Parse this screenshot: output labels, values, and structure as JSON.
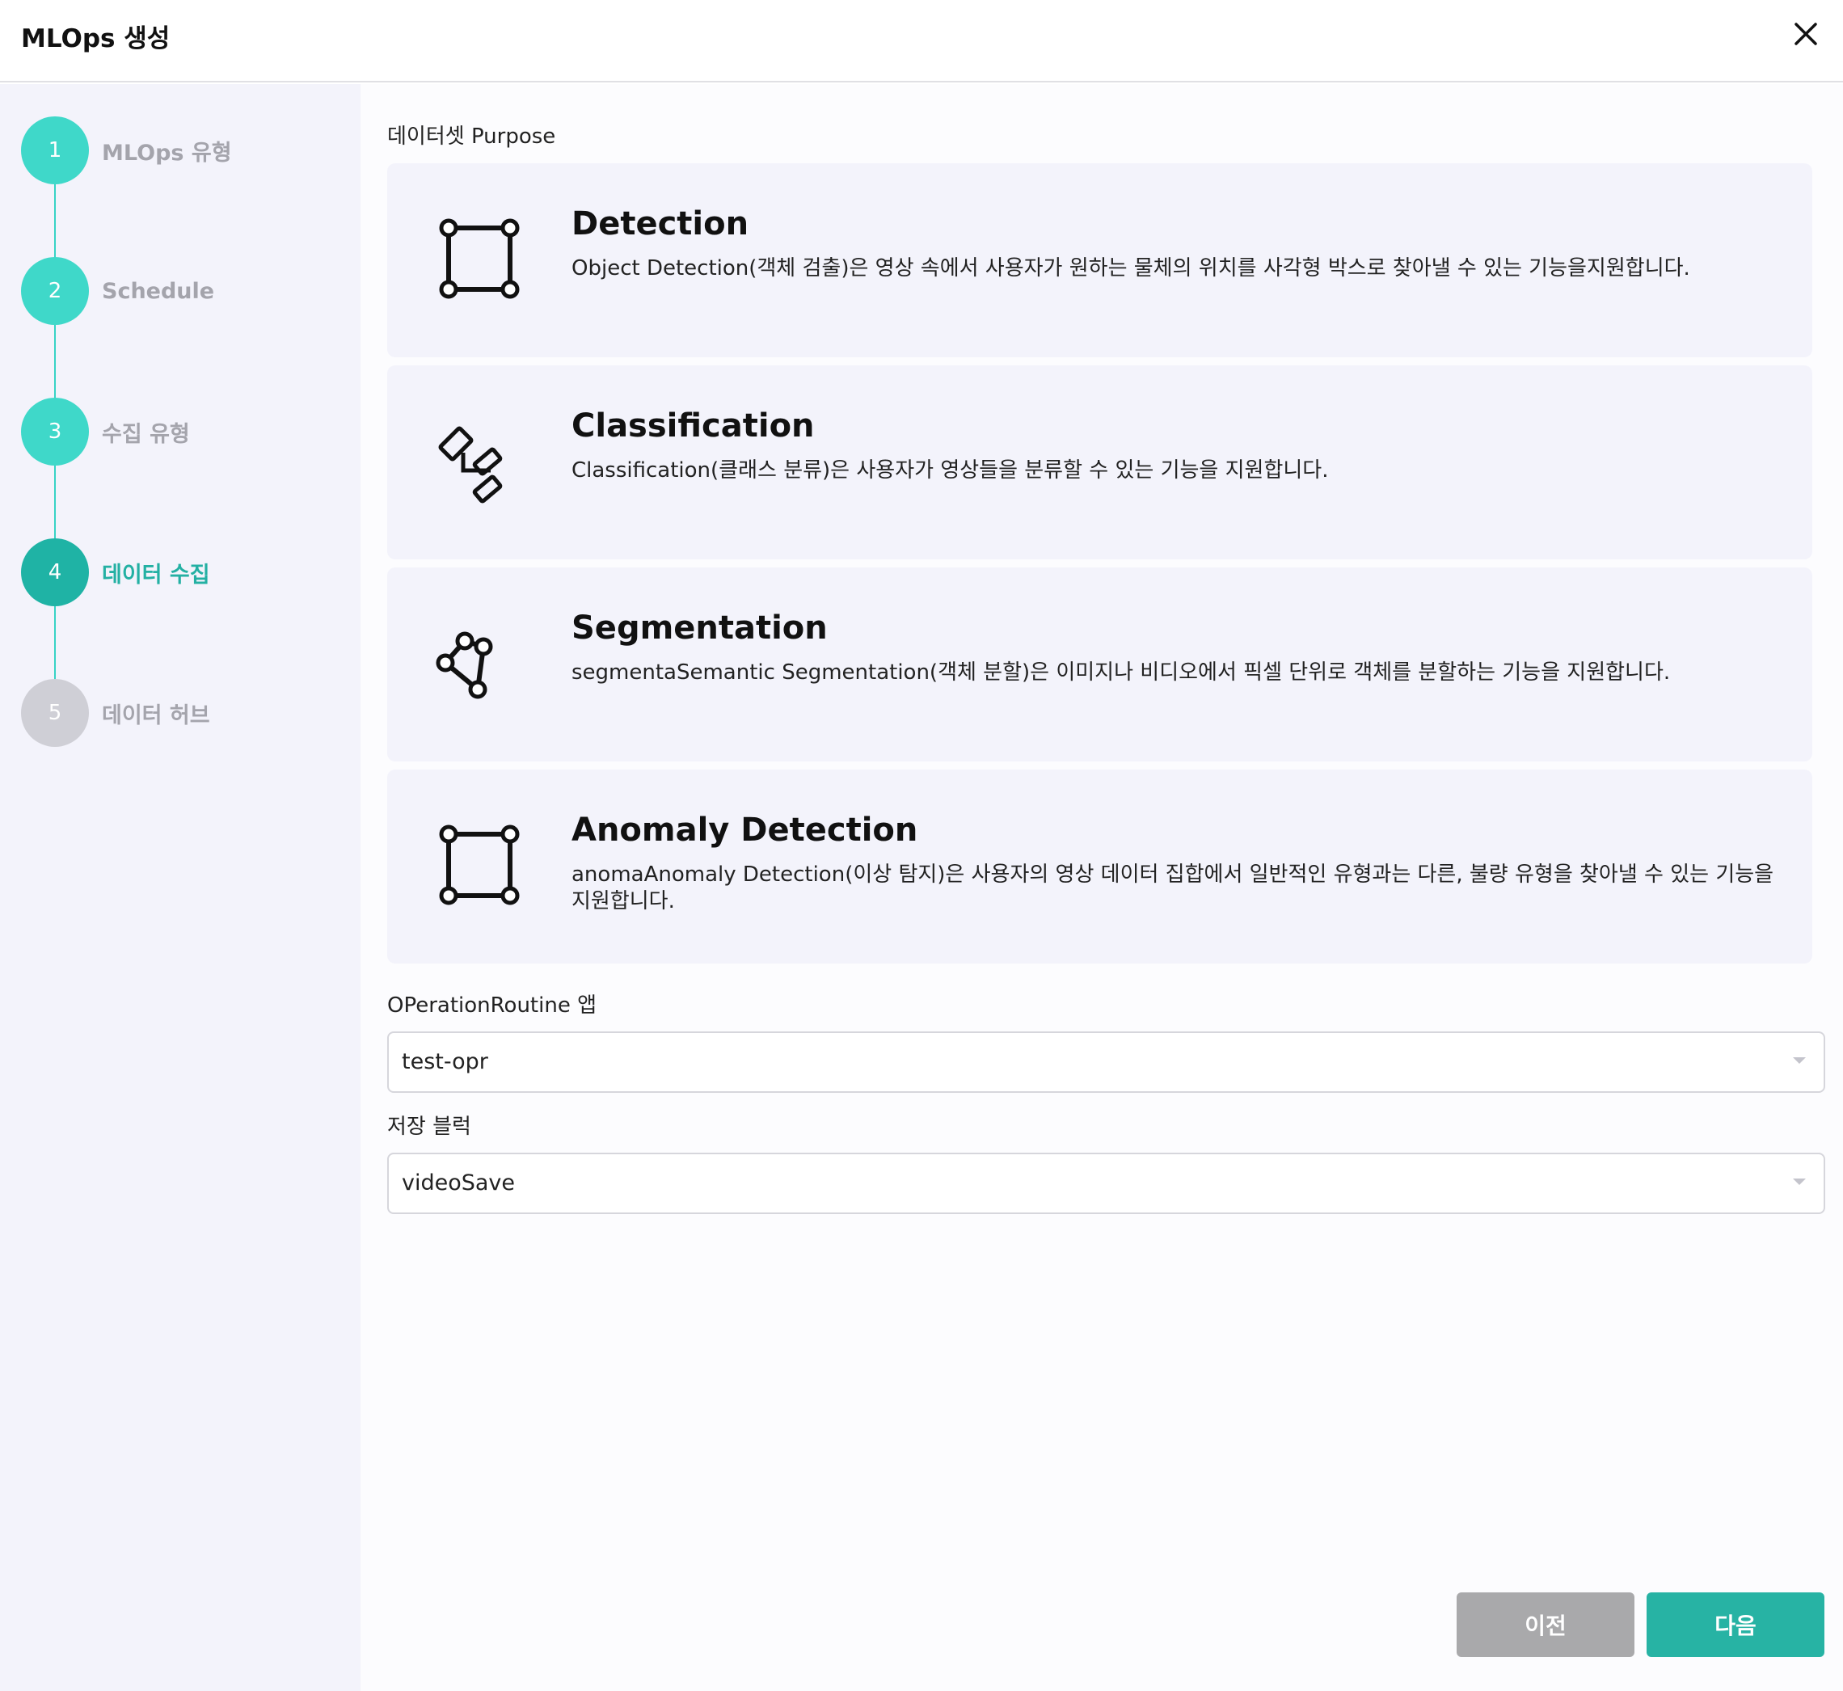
{
  "header": {
    "title": "MLOps 생성"
  },
  "steps": [
    {
      "number": "1",
      "label": "MLOps 유형"
    },
    {
      "number": "2",
      "label": "Schedule"
    },
    {
      "number": "3",
      "label": "수집 유형"
    },
    {
      "number": "4",
      "label": "데이터 수집"
    },
    {
      "number": "5",
      "label": "데이터 허브"
    }
  ],
  "current_step": "4",
  "purpose_label": "데이터셋 Purpose",
  "cards": [
    {
      "title": "Detection",
      "icon": "bounding-box-icon",
      "desc": "Object Detection(객체 검출)은 영상 속에서 사용자가 원하는 물체의 위치를 사각형 박스로 찾아낼 수 있는 기능을지원합니다."
    },
    {
      "title": "Classification",
      "icon": "hierarchy-icon",
      "desc": "Classification(클래스 분류)은 사용자가 영상들을 분류할 수 있는 기능을 지원합니다."
    },
    {
      "title": "Segmentation",
      "icon": "polygon-icon",
      "desc": "segmentaSemantic Segmentation(객체 분할)은 이미지나 비디오에서 픽셀 단위로 객체를 분할하는 기능을 지원합니다."
    },
    {
      "title": "Anomaly Detection",
      "icon": "bounding-box-icon",
      "desc": "anomaAnomaly Detection(이상 탐지)은 사용자의 영상 데이터 집합에서 일반적인 유형과는 다른, 불량 유형을 찾아낼 수 있는 기능을 지원합니다."
    }
  ],
  "operation_routine": {
    "label": "OPerationRoutine 앱",
    "value": "test-opr"
  },
  "storage_block": {
    "label": "저장 블럭",
    "value": "videoSave"
  },
  "buttons": {
    "prev": "이전",
    "next": "다음"
  },
  "colors": {
    "accent": "#27b3a4",
    "step_done": "#3fd8c9",
    "step_pending": "#cfcfd6",
    "prev_button": "#a9a9ab"
  }
}
